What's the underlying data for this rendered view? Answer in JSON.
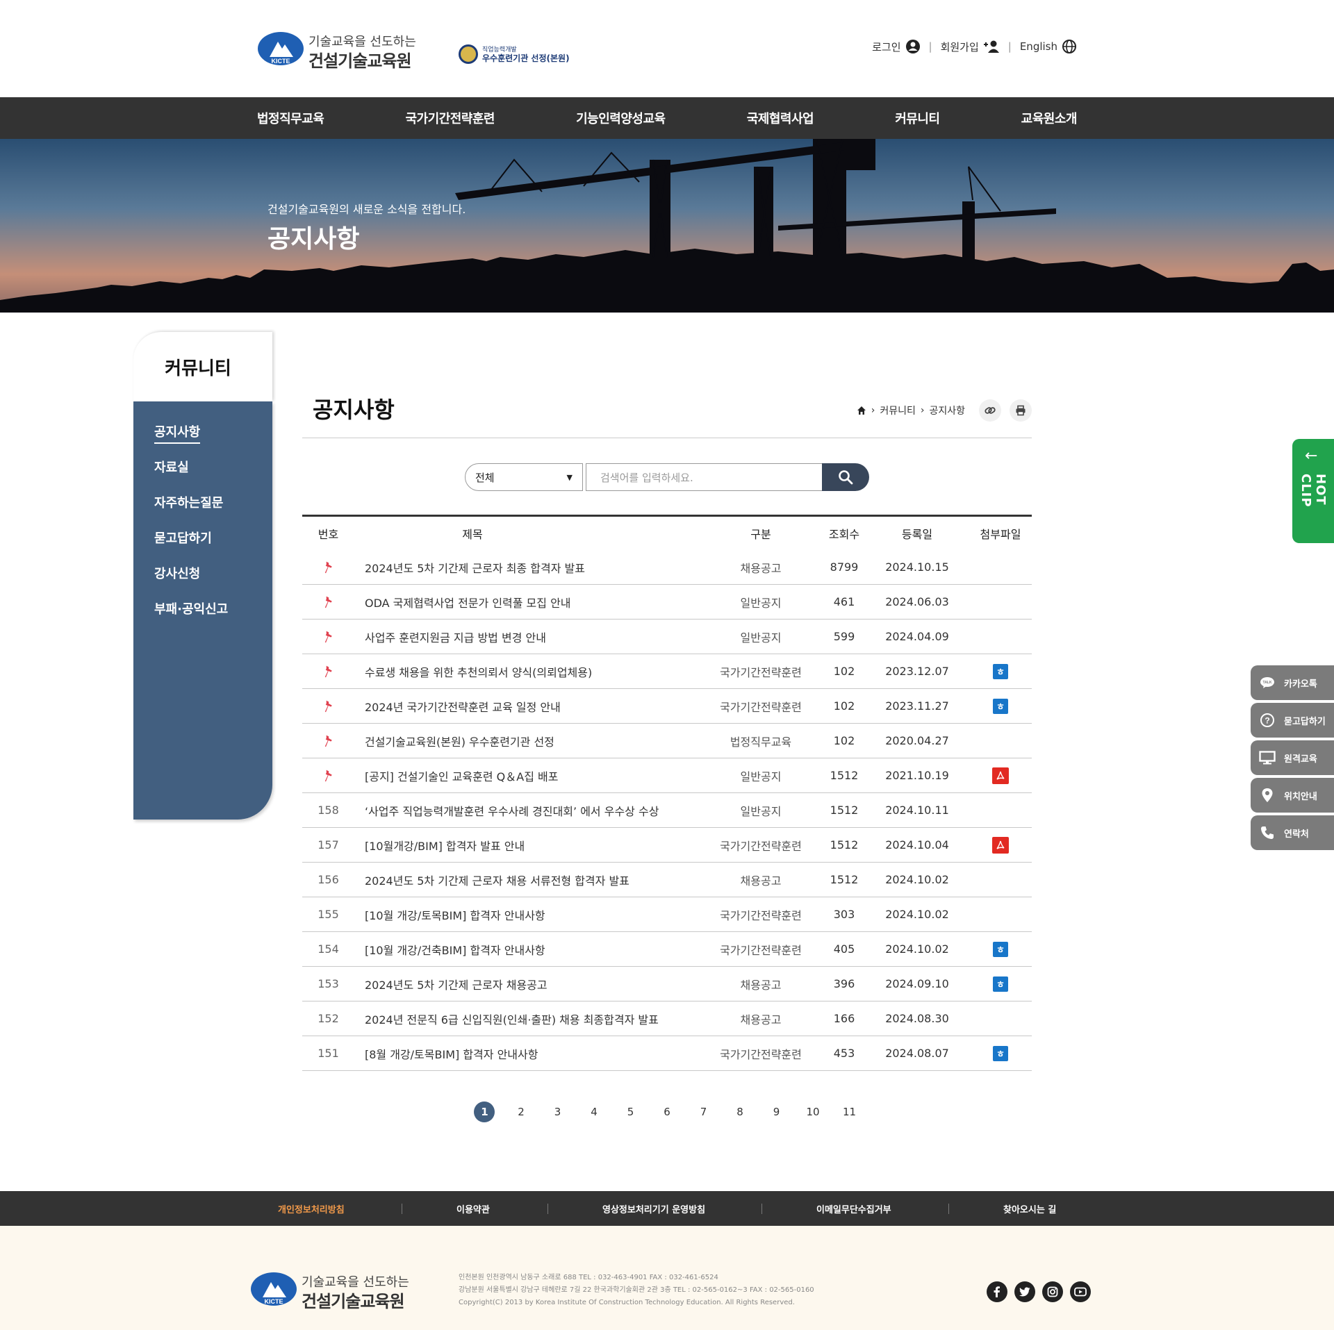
{
  "header": {
    "logo_tagline": "기술교육을 선도하는",
    "logo_name": "건설기술교육원",
    "logo_emblem_text": "KICTE",
    "cert_small": "직업능력개발",
    "cert_text": "우수훈련기관 선정(본원)",
    "util": {
      "login": "로그인",
      "join": "회원가입",
      "english": "English"
    }
  },
  "gnb": [
    "법정직무교육",
    "국가기간전략훈련",
    "기능인력양성교육",
    "국제협력사업",
    "커뮤니티",
    "교육원소개"
  ],
  "hero": {
    "subtitle": "건설기술교육원의 새로운 소식을 전합니다.",
    "title": "공지사항"
  },
  "lnb": {
    "title": "커뮤니티",
    "items": [
      "공지사항",
      "자료실",
      "자주하는질문",
      "묻고답하기",
      "강사신청",
      "부패·공익신고"
    ]
  },
  "content": {
    "title": "공지사항",
    "breadcrumb": [
      "커뮤니티",
      "공지사항"
    ]
  },
  "search": {
    "select_value": "전체",
    "placeholder": "검색어를 입력하세요."
  },
  "board": {
    "headers": {
      "no": "번호",
      "title": "제목",
      "category": "구분",
      "views": "조회수",
      "date": "등록일",
      "file": "첨부파일"
    },
    "rows": [
      {
        "no": "",
        "notice": true,
        "title": "2024년도 5차 기간제 근로자 최종 합격자 발표",
        "category": "채용공고",
        "views": "8799",
        "date": "2024.10.15",
        "file": ""
      },
      {
        "no": "",
        "notice": true,
        "title": "ODA 국제협력사업 전문가 인력풀 모집 안내",
        "category": "일반공지",
        "views": "461",
        "date": "2024.06.03",
        "file": ""
      },
      {
        "no": "",
        "notice": true,
        "title": "사업주 훈련지원금 지급 방법 변경 안내",
        "category": "일반공지",
        "views": "599",
        "date": "2024.04.09",
        "file": ""
      },
      {
        "no": "",
        "notice": true,
        "title": "수료생 채용을 위한 추천의뢰서 양식(의뢰업체용)",
        "category": "국가기간전략훈련",
        "views": "102",
        "date": "2023.12.07",
        "file": "hwp"
      },
      {
        "no": "",
        "notice": true,
        "title": "2024년 국가기간전략훈련 교육 일정 안내",
        "category": "국가기간전략훈련",
        "views": "102",
        "date": "2023.11.27",
        "file": "hwp"
      },
      {
        "no": "",
        "notice": true,
        "title": "건설기술교육원(본원) 우수훈련기관 선정",
        "category": "법정직무교육",
        "views": "102",
        "date": "2020.04.27",
        "file": ""
      },
      {
        "no": "",
        "notice": true,
        "title": "[공지] 건설기술인 교육훈련 Q＆A집 배포",
        "category": "일반공지",
        "views": "1512",
        "date": "2021.10.19",
        "file": "pdf"
      },
      {
        "no": "158",
        "notice": false,
        "title": "‘사업주 직업능력개발훈련 우수사례 경진대회’ 에서 우수상 수상",
        "category": "일반공지",
        "views": "1512",
        "date": "2024.10.11",
        "file": ""
      },
      {
        "no": "157",
        "notice": false,
        "title": "[10월개강/BIM] 합격자 발표 안내",
        "category": "국가기간전략훈련",
        "views": "1512",
        "date": "2024.10.04",
        "file": "pdf"
      },
      {
        "no": "156",
        "notice": false,
        "title": "2024년도 5차 기간제 근로자 채용 서류전형 합격자 발표",
        "category": "채용공고",
        "views": "1512",
        "date": "2024.10.02",
        "file": ""
      },
      {
        "no": "155",
        "notice": false,
        "title": "[10월 개강/토목BIM] 합격자 안내사항",
        "category": "국가기간전략훈련",
        "views": "303",
        "date": "2024.10.02",
        "file": ""
      },
      {
        "no": "154",
        "notice": false,
        "title": "[10월 개강/건축BIM] 합격자 안내사항",
        "category": "국가기간전략훈련",
        "views": "405",
        "date": "2024.10.02",
        "file": "hwp"
      },
      {
        "no": "153",
        "notice": false,
        "title": "2024년도 5차 기간제 근로자 채용공고",
        "category": "채용공고",
        "views": "396",
        "date": "2024.09.10",
        "file": "hwp"
      },
      {
        "no": "152",
        "notice": false,
        "title": "2024년 전문직 6급 신입직원(인쇄·출판) 채용 최종합격자 발표",
        "category": "채용공고",
        "views": "166",
        "date": "2024.08.30",
        "file": ""
      },
      {
        "no": "151",
        "notice": false,
        "title": "[8월 개강/토목BIM] 합격자 안내사항",
        "category": "국가기간전략훈련",
        "views": "453",
        "date": "2024.08.07",
        "file": "hwp"
      }
    ]
  },
  "pagination": {
    "pages": [
      "1",
      "2",
      "3",
      "4",
      "5",
      "6",
      "7",
      "8",
      "9",
      "10",
      "11"
    ],
    "current": "1"
  },
  "hotclip": {
    "label": "HOT CLIP"
  },
  "quick": [
    "카카오톡",
    "묻고답하기",
    "원격교육",
    "위치안내",
    "연락처"
  ],
  "footer_nav": [
    "개인정보처리방침",
    "이용약관",
    "영상정보처리기기 운영방침",
    "이메일무단수집거부",
    "찾아오시는 길"
  ],
  "footer": {
    "addr1": "인천본원    인천광역시 남동구 소래로 688    TEL : 032-463-4901    FAX : 032-461-6524",
    "addr2": "강남분원    서울특별시 강남구 테헤란로 7길 22 한국과학기술회관 2관 3층    TEL : 02-565-0162~3    FAX : 02-565-0160",
    "copyright": "Copyright(C) 2013 by Korea Institute Of Construction Technology Education. All Rights Reserved."
  },
  "colors": {
    "gnb_bg": "#333333",
    "lnb_bg": "#425f80",
    "hotclip": "#21a34d",
    "footer_highlight": "#f29a4a",
    "pin": "#e0414f"
  }
}
